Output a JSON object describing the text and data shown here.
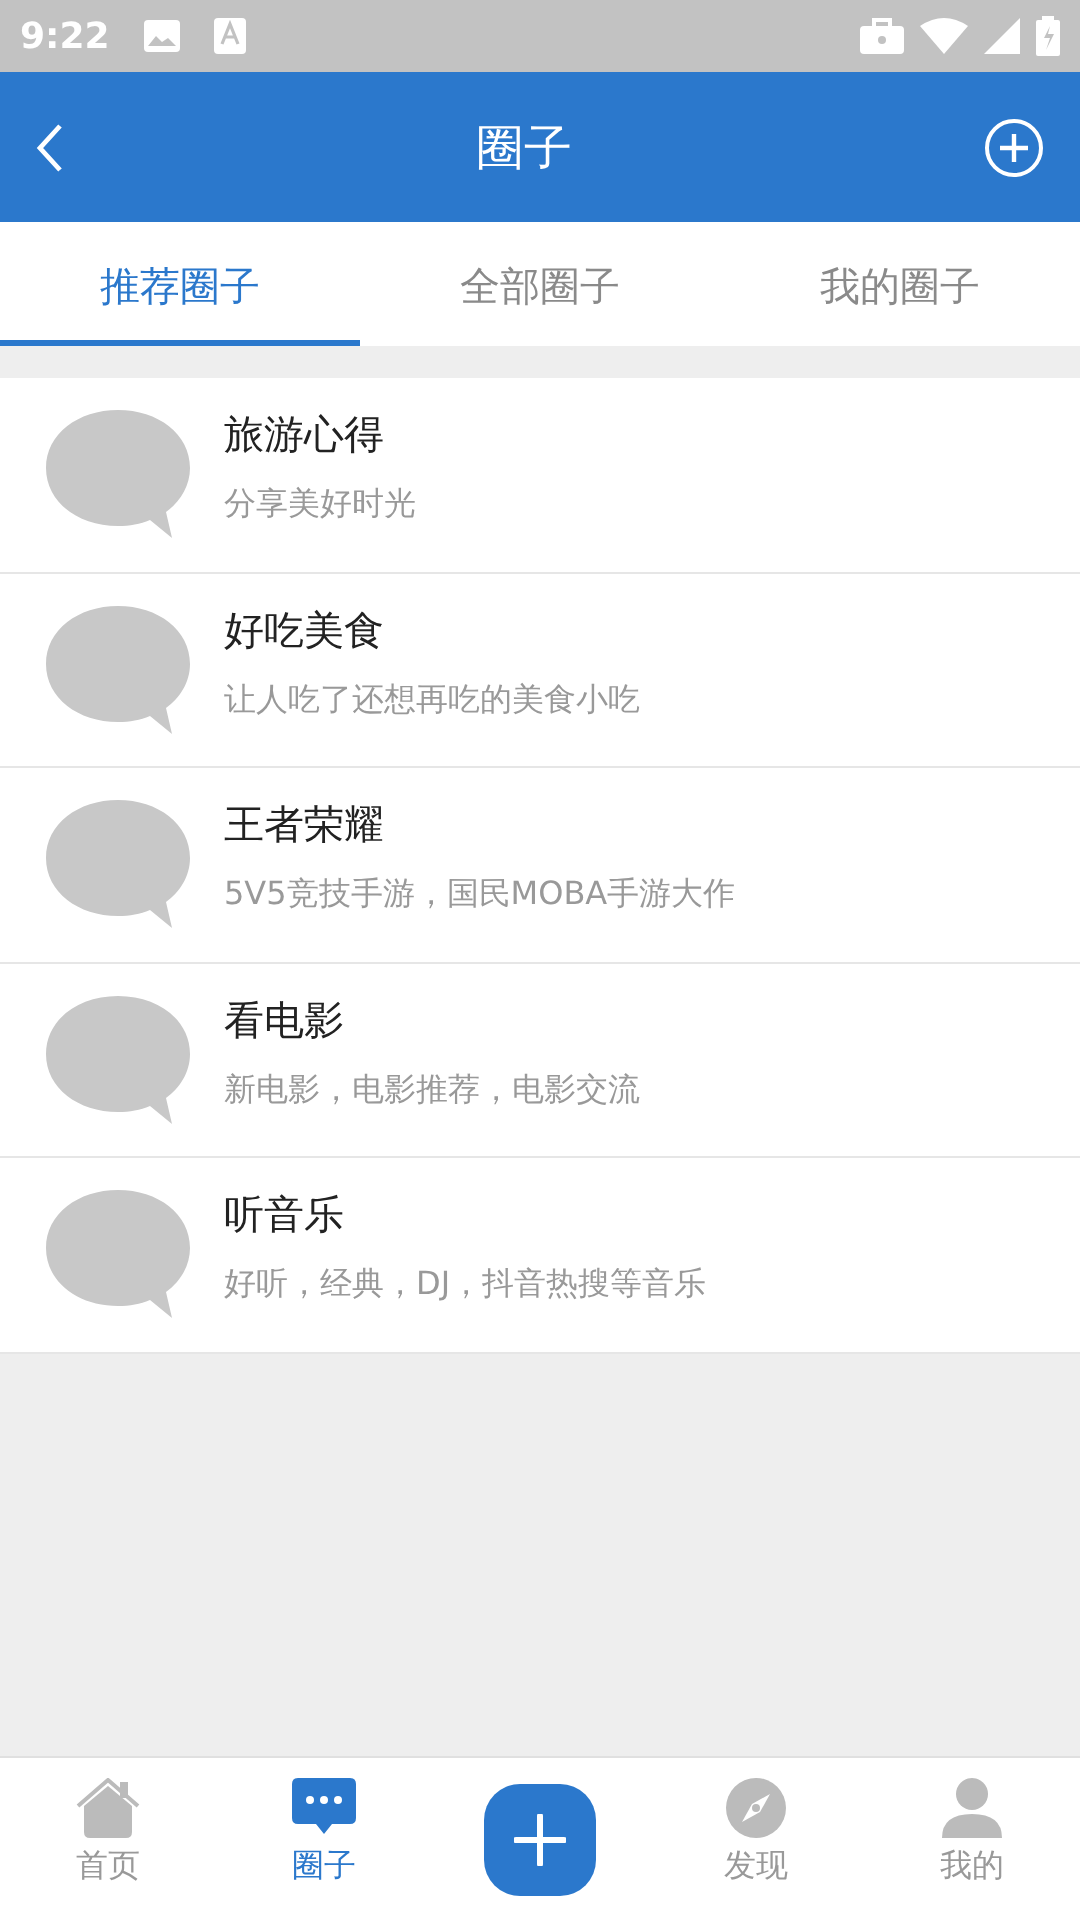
{
  "status_bar": {
    "time": "9:22"
  },
  "header": {
    "title": "圈子"
  },
  "tabs": [
    {
      "label": "推荐圈子",
      "selected": true
    },
    {
      "label": "全部圈子",
      "selected": false
    },
    {
      "label": "我的圈子",
      "selected": false
    }
  ],
  "circles": [
    {
      "name": "旅游心得",
      "description": "分享美好时光"
    },
    {
      "name": "好吃美食",
      "description": "让人吃了还想再吃的美食小吃"
    },
    {
      "name": "王者荣耀",
      "description": "5V5竞技手游，国民MOBA手游大作"
    },
    {
      "name": "看电影",
      "description": "新电影，电影推荐，电影交流"
    },
    {
      "name": "听音乐",
      "description": "好听，经典，DJ，抖音热搜等音乐"
    }
  ],
  "bottom_nav": [
    {
      "kind": "home",
      "label": "首页",
      "selected": false
    },
    {
      "kind": "circle",
      "label": "圈子",
      "selected": true
    },
    {
      "kind": "add"
    },
    {
      "kind": "discover",
      "label": "发现",
      "selected": false
    },
    {
      "kind": "me",
      "label": "我的",
      "selected": false
    }
  ]
}
